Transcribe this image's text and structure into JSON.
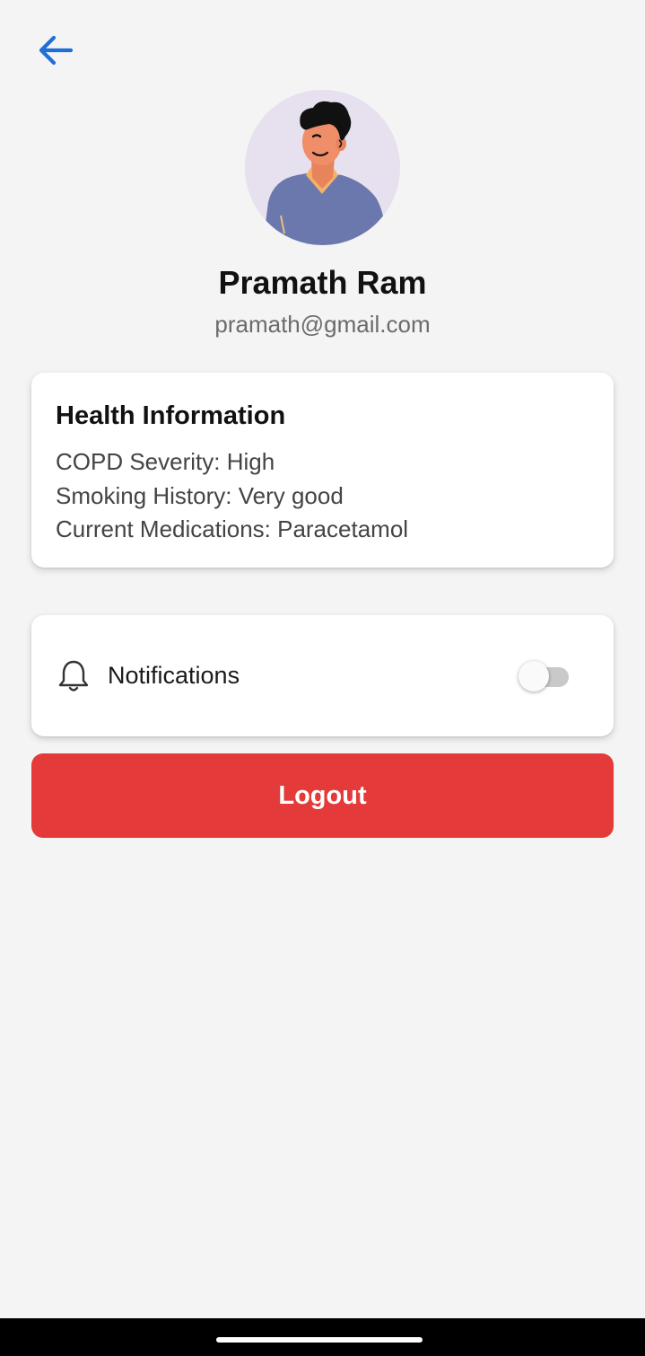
{
  "profile": {
    "name": "Pramath Ram",
    "email": "pramath@gmail.com"
  },
  "health": {
    "title": "Health Information",
    "lines": [
      "COPD Severity: High",
      "Smoking History: Very good",
      "Current Medications: Paracetamol"
    ]
  },
  "settings": {
    "notifications_label": "Notifications",
    "notifications_enabled": false
  },
  "actions": {
    "logout_label": "Logout"
  },
  "icons": {
    "back": "arrow-left-icon",
    "bell": "bell-icon"
  },
  "colors": {
    "accent": "#1f6fd6",
    "logout": "#e43b3a",
    "background": "#f4f4f5"
  }
}
